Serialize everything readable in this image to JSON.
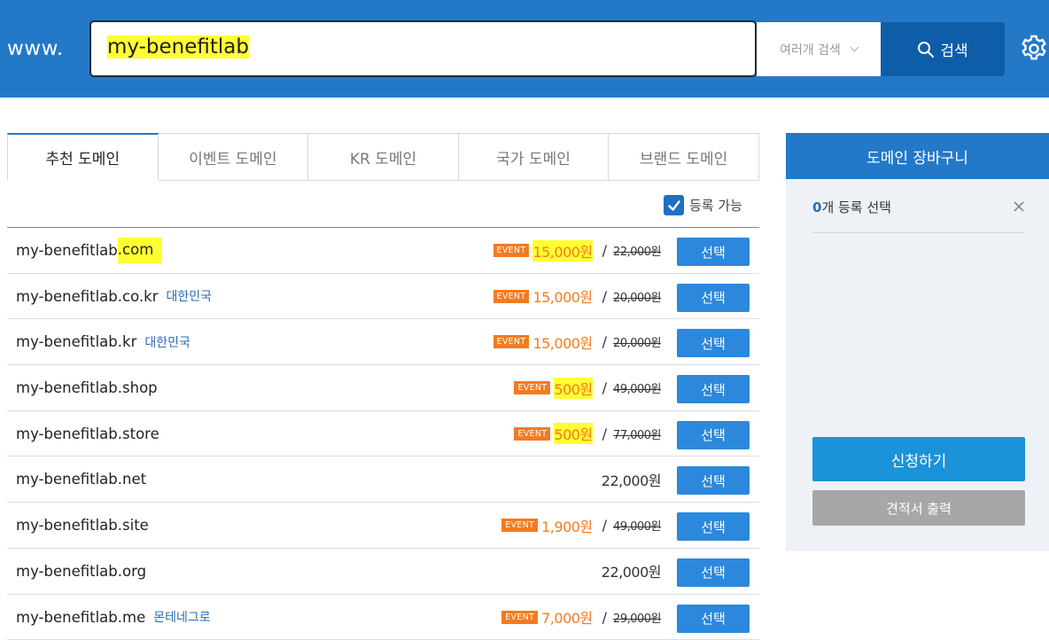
{
  "header": {
    "prefix": "www.",
    "search_value": "my-benefitlab",
    "multi_search_label": "여러개 검색",
    "search_button_label": "검색"
  },
  "tabs": [
    {
      "label": "추천 도메인",
      "active": true
    },
    {
      "label": "이벤트 도메인",
      "active": false
    },
    {
      "label": "KR 도메인",
      "active": false
    },
    {
      "label": "국가 도메인",
      "active": false
    },
    {
      "label": "브랜드 도메인",
      "active": false
    }
  ],
  "filter": {
    "label": "등록 가능",
    "checked": true
  },
  "domains": [
    {
      "base": "my-benefitlab",
      "tld": ".com",
      "tld_highlight": true,
      "country": "",
      "event": "EVENT",
      "price": "15,000원",
      "price_highlight": true,
      "original": "22,000원",
      "select_label": "선택"
    },
    {
      "base": "my-benefitlab",
      "tld": ".co.kr",
      "tld_highlight": false,
      "country": "대한민국",
      "event": "EVENT",
      "price": "15,000원",
      "price_highlight": false,
      "original": "20,000원",
      "select_label": "선택"
    },
    {
      "base": "my-benefitlab",
      "tld": ".kr",
      "tld_highlight": false,
      "country": "대한민국",
      "event": "EVENT",
      "price": "15,000원",
      "price_highlight": false,
      "original": "20,000원",
      "select_label": "선택"
    },
    {
      "base": "my-benefitlab",
      "tld": ".shop",
      "tld_highlight": false,
      "country": "",
      "event": "EVENT",
      "price": "500원",
      "price_highlight": true,
      "original": "49,000원",
      "select_label": "선택"
    },
    {
      "base": "my-benefitlab",
      "tld": ".store",
      "tld_highlight": false,
      "country": "",
      "event": "EVENT",
      "price": "500원",
      "price_highlight": true,
      "original": "77,000원",
      "select_label": "선택"
    },
    {
      "base": "my-benefitlab",
      "tld": ".net",
      "tld_highlight": false,
      "country": "",
      "event": "",
      "price": "22,000원",
      "price_highlight": false,
      "original": "",
      "select_label": "선택"
    },
    {
      "base": "my-benefitlab",
      "tld": ".site",
      "tld_highlight": false,
      "country": "",
      "event": "EVENT",
      "price": "1,900원",
      "price_highlight": false,
      "original": "49,000원",
      "select_label": "선택"
    },
    {
      "base": "my-benefitlab",
      "tld": ".org",
      "tld_highlight": false,
      "country": "",
      "event": "",
      "price": "22,000원",
      "price_highlight": false,
      "original": "",
      "select_label": "선택"
    },
    {
      "base": "my-benefitlab",
      "tld": ".me",
      "tld_highlight": false,
      "country": "몬테네그로",
      "event": "EVENT",
      "price": "7,000원",
      "price_highlight": false,
      "original": "29,000원",
      "select_label": "선택"
    }
  ],
  "cart": {
    "title": "도메인 장바구니",
    "count": "0",
    "count_suffix": "개 등록 선택",
    "apply_label": "신청하기",
    "quote_label": "견적서 출력"
  },
  "colors": {
    "brand_blue": "#2379c8",
    "event_orange": "#f47b20",
    "highlight_yellow": "#ffff33",
    "select_button": "#2b88dc"
  }
}
